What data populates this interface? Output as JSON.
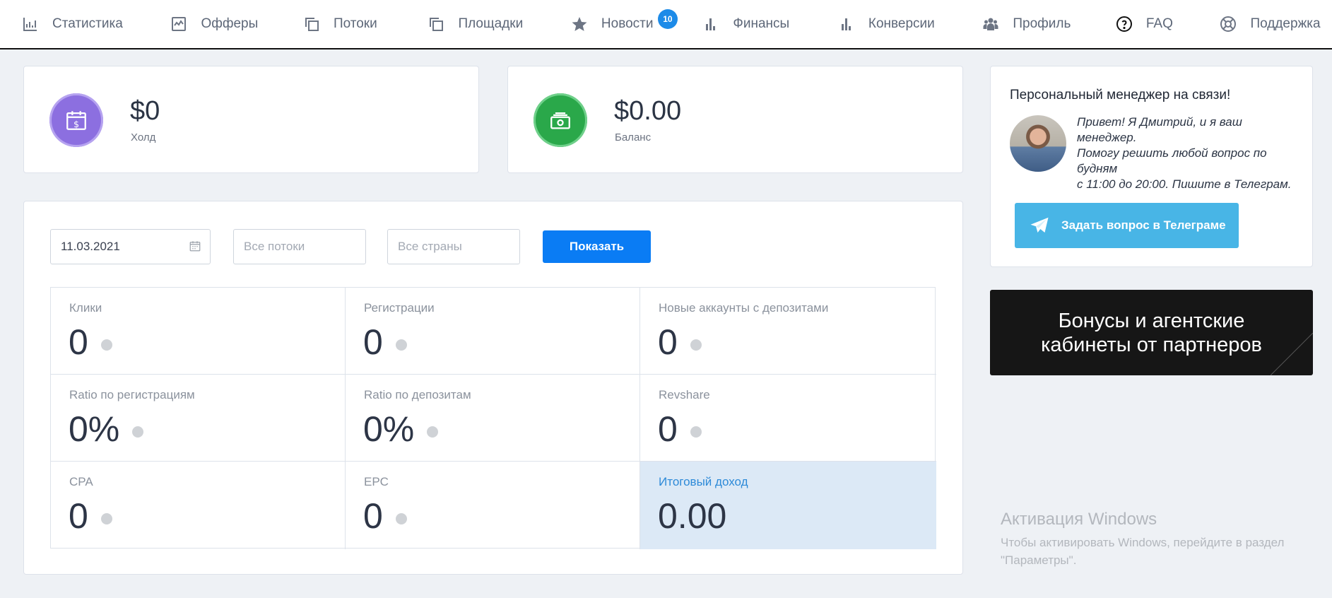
{
  "nav": {
    "items": [
      {
        "label": "Статистика",
        "icon": "bar-chart-icon"
      },
      {
        "label": "Офферы",
        "icon": "line-chart-icon"
      },
      {
        "label": "Потоки",
        "icon": "copy-icon"
      },
      {
        "label": "Площадки",
        "icon": "copy-icon"
      },
      {
        "label": "Новости",
        "icon": "star-icon",
        "badge": "10"
      },
      {
        "label": "Финансы",
        "icon": "bar-chart-icon"
      },
      {
        "label": "Конверсии",
        "icon": "bar-chart-icon"
      },
      {
        "label": "Профиль",
        "icon": "users-icon"
      },
      {
        "label": "FAQ",
        "icon": "question-icon"
      },
      {
        "label": "Поддержка",
        "icon": "lifebuoy-icon"
      }
    ]
  },
  "hold": {
    "value": "$0",
    "label": "Холд",
    "icon": "calendar-dollar-icon",
    "color": "#8c6fe0"
  },
  "balance": {
    "value": "$0.00",
    "label": "Баланс",
    "icon": "money-icon",
    "color": "#2aa84a"
  },
  "filters": {
    "date": "11.03.2021",
    "streams_placeholder": "Все потоки",
    "countries_placeholder": "Все страны",
    "show_label": "Показать"
  },
  "metrics": [
    {
      "label": "Клики",
      "value": "0"
    },
    {
      "label": "Регистрации",
      "value": "0"
    },
    {
      "label": "Новые аккаунты с депозитами",
      "value": "0"
    },
    {
      "label": "Ratio по регистрациям",
      "value": "0%"
    },
    {
      "label": "Ratio по депозитам",
      "value": "0%"
    },
    {
      "label": "Revshare",
      "value": "0"
    },
    {
      "label": "CPA",
      "value": "0"
    },
    {
      "label": "EPC",
      "value": "0"
    },
    {
      "label": "Итоговый доход",
      "value": "0.00"
    }
  ],
  "manager": {
    "title": "Персональный менеджер на связи!",
    "lines": [
      "Привет! Я Дмитрий, и я ваш",
      "менеджер.",
      "Помогу решить любой вопрос по",
      "будням",
      "с 11:00 до 20:00. Пишите в Телеграм."
    ],
    "button": "Задать вопрос в Телеграме"
  },
  "bonus": {
    "line1": "Бонусы и агентские",
    "line2": "кабинеты от партнеров"
  },
  "watermark": {
    "title": "Активация Windows",
    "line1": "Чтобы активировать Windows, перейдите в раздел",
    "line2": "\"Параметры\"."
  },
  "colors": {
    "accent": "#0a7cf4",
    "telegram": "#48b5e6",
    "badge": "#1d8be8",
    "highlight": "#dce9f6"
  }
}
